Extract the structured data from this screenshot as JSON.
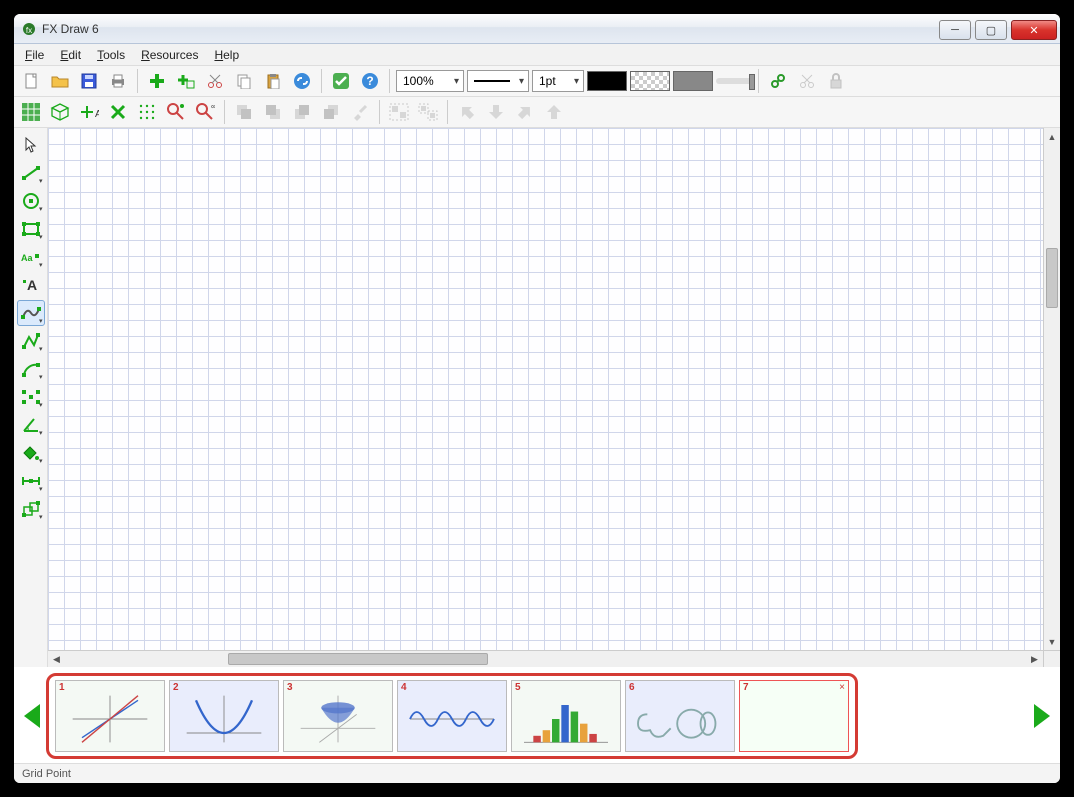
{
  "window": {
    "title": "FX Draw 6"
  },
  "menu": {
    "items": [
      "File",
      "Edit",
      "Tools",
      "Resources",
      "Help"
    ]
  },
  "toolbar1": {
    "zoom": "100%",
    "lineStyle": "———",
    "lineWeight": "1pt",
    "icons": [
      "new-file-icon",
      "open-folder-icon",
      "save-icon",
      "print-icon",
      "add-plus-icon",
      "add-plus2-icon",
      "cut-icon",
      "copy-icon",
      "paste-icon",
      "link-icon",
      "check-icon",
      "help-icon"
    ],
    "right_icons": [
      "link-tool-icon",
      "cut2-icon",
      "lock-icon"
    ]
  },
  "toolbar2": {
    "icons": [
      "grid-icon",
      "3d-grid-icon",
      "add-to-axis-icon",
      "x-green-icon",
      "dots-icon",
      "constraint-a-icon",
      "constraint-b-icon",
      "layer-back-icon",
      "layer-b2-icon",
      "layer-f2-icon",
      "layer-front-icon",
      "brush-icon",
      "group-icon",
      "ungroup-icon",
      "rotate-l-icon",
      "rotate-d-icon",
      "rotate-r-icon",
      "rotate-u-icon"
    ]
  },
  "left_tools": [
    {
      "name": "select-tool",
      "drop": false
    },
    {
      "name": "line-tool",
      "drop": true
    },
    {
      "name": "circle-tool",
      "drop": true
    },
    {
      "name": "rect-tool",
      "drop": true
    },
    {
      "name": "label-tool",
      "drop": true
    },
    {
      "name": "text-tool",
      "drop": false
    },
    {
      "name": "curve-tool",
      "drop": true,
      "selected": true
    },
    {
      "name": "polyline-tool",
      "drop": true
    },
    {
      "name": "arc-tool",
      "drop": true
    },
    {
      "name": "points-tool",
      "drop": true
    },
    {
      "name": "angle-tool",
      "drop": true
    },
    {
      "name": "fill-tool",
      "drop": true
    },
    {
      "name": "measure-tool",
      "drop": true
    },
    {
      "name": "transform-tool",
      "drop": true
    }
  ],
  "thumbnails": [
    {
      "num": "1",
      "kind": "graph-lines"
    },
    {
      "num": "2",
      "kind": "parabola"
    },
    {
      "num": "3",
      "kind": "paraboloid-3d"
    },
    {
      "num": "4",
      "kind": "sine-wave"
    },
    {
      "num": "5",
      "kind": "histogram"
    },
    {
      "num": "6",
      "kind": "shapes"
    },
    {
      "num": "7",
      "kind": "blank",
      "selected": true
    }
  ],
  "status": {
    "text": "Grid Point"
  }
}
